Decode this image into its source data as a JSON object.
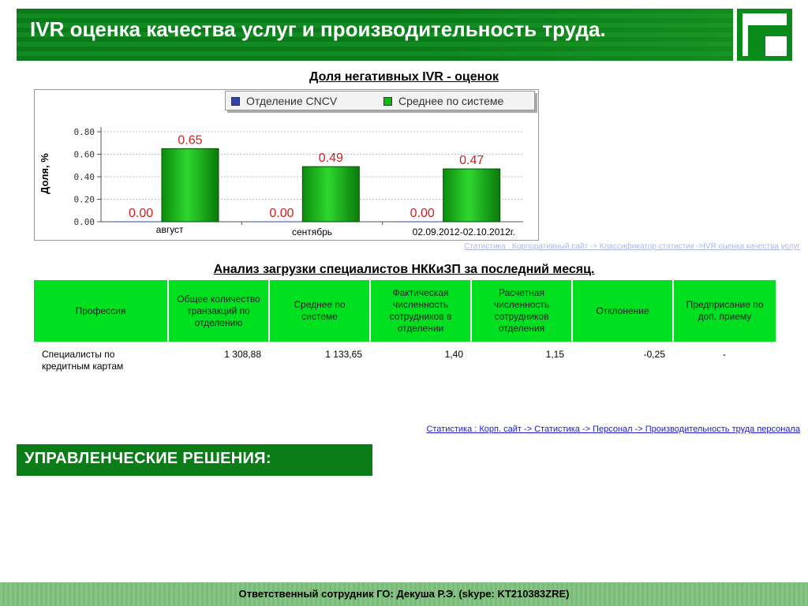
{
  "header": {
    "title": "IVR оценка качества услуг и производительность труда."
  },
  "chart_section": {
    "title": "Доля негативных IVR - оценок",
    "source": "Статистика : Корпоративный сайт -> Классификатор статистик ->IVR оценка качества услуг"
  },
  "colors": {
    "brand": "#0a7d16",
    "bar_green": "#12b812",
    "table_header": "#00e020",
    "link": "#1a1acc",
    "value_label": "#cc2222"
  },
  "chart_data": {
    "type": "bar",
    "ylabel": "Доля, %",
    "xlabel": "",
    "categories": [
      "август",
      "сентябрь",
      "02.09.2012-02.10.2012г."
    ],
    "series": [
      {
        "name": "Отделение CNCV",
        "color": "#3344aa",
        "values": [
          0.0,
          0.0,
          0.0
        ],
        "labels": [
          "0.00",
          "0.00",
          "0.00"
        ]
      },
      {
        "name": "Среднее по системе",
        "color": "#12b812",
        "values": [
          0.65,
          0.49,
          0.47
        ],
        "labels": [
          "0.65",
          "0.49",
          "0.47"
        ]
      }
    ],
    "ylim": [
      0,
      0.8
    ],
    "yticks": [
      0.0,
      0.2,
      0.4,
      0.6,
      0.8
    ],
    "ytick_labels": [
      "0.00",
      "0.20",
      "0.40",
      "0.60",
      "0.80"
    ],
    "grid": true,
    "legend": "top"
  },
  "table_section": {
    "title": "Анализ загрузки специалистов НККиЗП за последний месяц.",
    "headers": [
      "Профессия",
      "Общее количество транзакций по отделению",
      "Среднее по системе",
      "Фактическая численность сотрудников в отделении",
      "Расчетная численность сотрудников отделения",
      "Отклонение",
      "Предприсание по доп. приему"
    ],
    "rows": [
      [
        "Специалисты по кредитным картам",
        "1 308,88",
        "1 133,65",
        "1,40",
        "1,15",
        "-0,25",
        "-"
      ]
    ],
    "source": "Статистика : Корп. сайт -> Статистика -> Персонал -> Производительность труда персонала"
  },
  "decisions": {
    "label": "УПРАВЛЕНЧЕСКИЕ РЕШЕНИЯ:"
  },
  "footer": {
    "text": "Ответственный сотрудник ГО: Декуша Р.Э. (skype: KT210383ZRE)"
  }
}
